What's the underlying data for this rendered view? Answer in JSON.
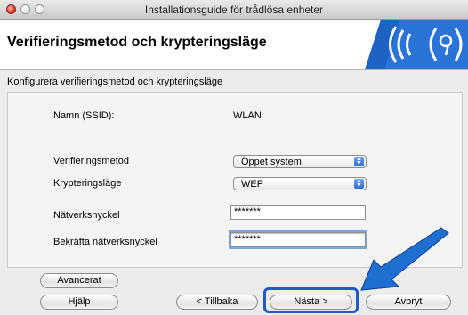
{
  "window": {
    "title": "Installationsguide för trådlösa enheter"
  },
  "header": {
    "title": "Verifieringsmetod och krypteringsläge"
  },
  "section": {
    "title": "Konfigurera verifieringsmetod och krypteringsläge"
  },
  "form": {
    "ssid_label": "Namn (SSID):",
    "ssid_value": "WLAN",
    "auth_label": "Verifieringsmetod",
    "auth_value": "Öppet system",
    "encryption_label": "Krypteringsläge",
    "encryption_value": "WEP",
    "key_label": "Nätverksnyckel",
    "key_value": "*******",
    "confirm_label": "Bekräfta nätverksnyckel",
    "confirm_value": "*******"
  },
  "buttons": {
    "advanced": "Avancerat",
    "help": "Hjälp",
    "back": "< Tillbaka",
    "next": "Nästa >",
    "cancel": "Avbryt"
  },
  "colors": {
    "highlight": "#1f5bc2",
    "arrow": "#1f6fd1",
    "logo": "#1d63c4"
  }
}
